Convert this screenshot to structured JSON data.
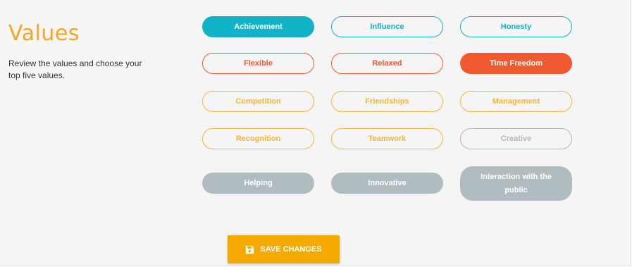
{
  "header": {
    "title": "Values",
    "description": "Review the values and choose your top five values."
  },
  "values": [
    {
      "label": "Achievement",
      "style": "teal-filled"
    },
    {
      "label": "Influence",
      "style": "teal-outline"
    },
    {
      "label": "Honesty",
      "style": "teal-outline"
    },
    {
      "label": "Flexible",
      "style": "red-outline"
    },
    {
      "label": "Relaxed",
      "style": "red-outline"
    },
    {
      "label": "Time Freedom",
      "style": "red-filled"
    },
    {
      "label": "Competition",
      "style": "yellow-outline"
    },
    {
      "label": "Friendships",
      "style": "yellow-outline"
    },
    {
      "label": "Management",
      "style": "yellow-outline"
    },
    {
      "label": "Recognition",
      "style": "yellow-outline"
    },
    {
      "label": "Teamwork",
      "style": "yellow-outline"
    },
    {
      "label": "Creative",
      "style": "gray-outline"
    },
    {
      "label": "Helping",
      "style": "gray-filled"
    },
    {
      "label": "Innovative",
      "style": "gray-filled"
    },
    {
      "label": "Interaction with the public",
      "style": "gray-filled"
    }
  ],
  "actions": {
    "save_label": "SAVE CHANGES",
    "save_icon": "floppy-disk-icon"
  },
  "colors": {
    "title": "#f5a623",
    "teal": "#10b4c6",
    "red": "#f05a30",
    "yellow": "#f5b63a",
    "gray": "#b0bcc0",
    "save_button": "#f5aa00"
  }
}
